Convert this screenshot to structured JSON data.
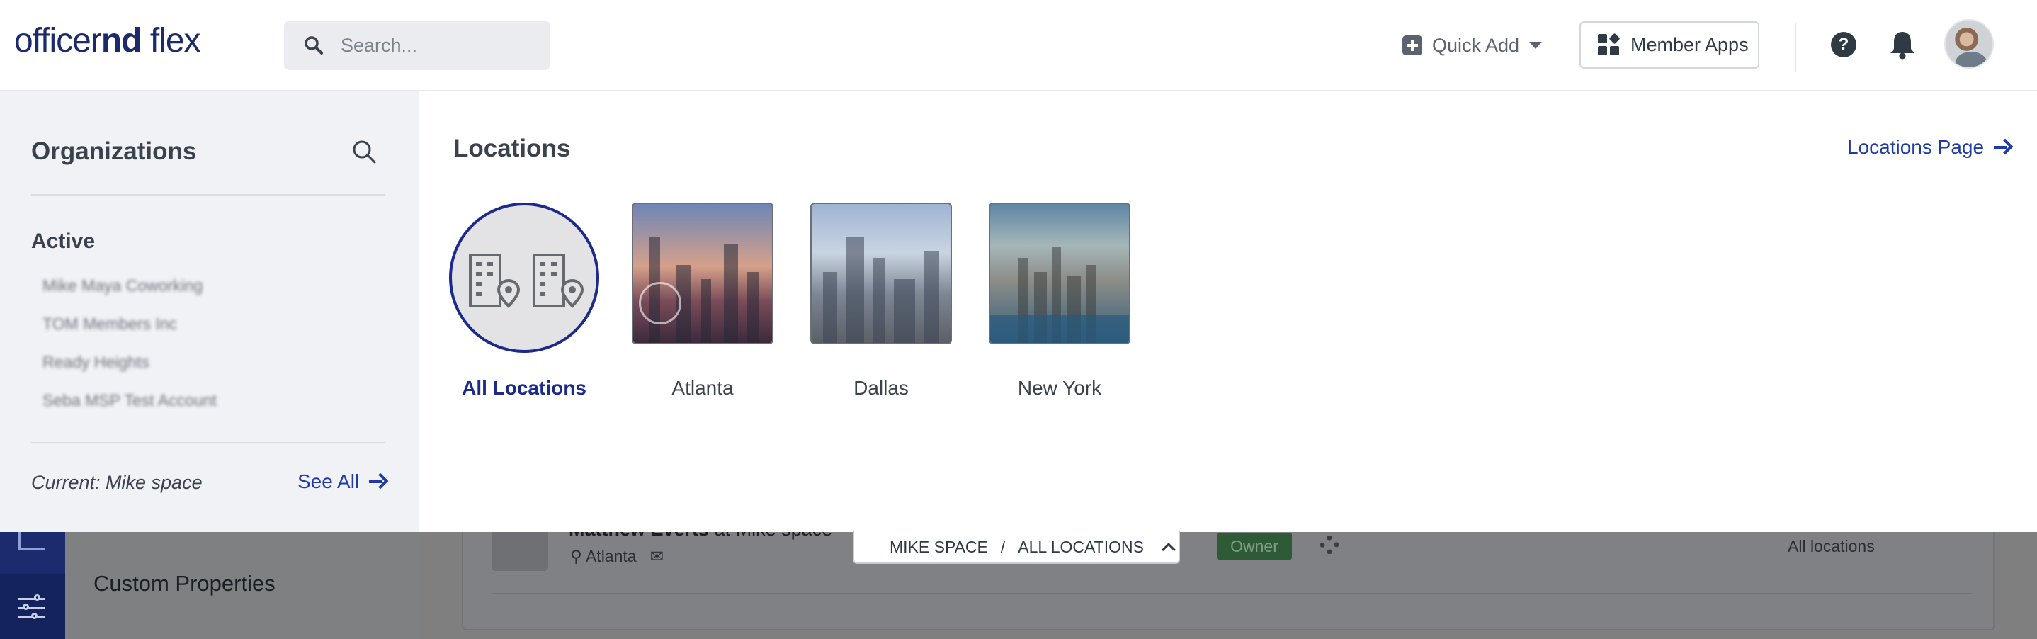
{
  "header": {
    "logo_regular": "officer",
    "logo_bold": "nd",
    "logo_suffix": " flex",
    "search_placeholder": "Search...",
    "quick_add_label": "Quick Add",
    "member_apps_label": "Member Apps",
    "help_icon": "?"
  },
  "organizations": {
    "title": "Organizations",
    "active_label": "Active",
    "items": [
      "Mike Maya Coworking",
      "TOM Members Inc",
      "Ready Heights",
      "Seba MSP Test Account"
    ],
    "current_label": "Current: Mike space",
    "see_all_label": "See All"
  },
  "locations": {
    "title": "Locations",
    "page_link_label": "Locations Page",
    "items": [
      {
        "label": "All Locations",
        "selected": true
      },
      {
        "label": "Atlanta",
        "selected": false
      },
      {
        "label": "Dallas",
        "selected": false
      },
      {
        "label": "New York",
        "selected": false
      }
    ]
  },
  "background": {
    "nav_item_label": "Custom Properties",
    "member_name": "Matthew Everts",
    "member_suffix": " at Mike space",
    "member_location": "Atlanta",
    "role_badge": "Owner",
    "access_label": "All locations"
  },
  "context_switcher": {
    "company": "MIKE SPACE",
    "separator": "/",
    "location": "ALL LOCATIONS"
  },
  "colors": {
    "brand_navy": "#1c2a6b",
    "link_blue": "#1f3aa8",
    "selected_ring": "#1c2a8c"
  }
}
